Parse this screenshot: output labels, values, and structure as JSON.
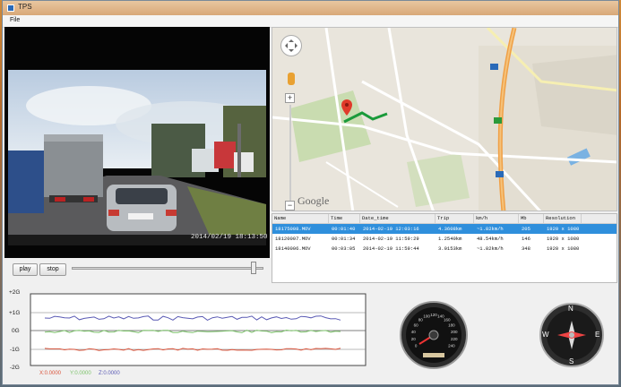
{
  "window": {
    "title": "TPS"
  },
  "menu": {
    "file": "File"
  },
  "video": {
    "timestamp": "2014/02/19 18:13:50"
  },
  "map": {
    "attribution": "Google",
    "zoom_in": "+",
    "zoom_out": "−"
  },
  "table": {
    "columns": [
      "Name",
      "Time",
      "Date_time",
      "Trip",
      "km/h",
      "Mb",
      "Resolution"
    ],
    "rows": [
      [
        "18175008.MOV",
        "00:01:40",
        "2014-02-19 12:03:16",
        "4.3608km",
        "~1.82km/h",
        "205",
        "1920 x 1080"
      ],
      [
        "18120007.MOV",
        "00:01:34",
        "2014-02-19 11:59:29",
        "1.2540km",
        "48.54km/h",
        "146",
        "1920 x 1080"
      ],
      [
        "18140006.MOV",
        "00:03:05",
        "2014-02-19 11:59:44",
        "3.0153km",
        "~1.82km/h",
        "348",
        "1920 x 1080"
      ]
    ],
    "selected_row": 0
  },
  "controls": {
    "play": "play",
    "stop": "stop",
    "position": 0.96
  },
  "gsensor": {
    "axis_labels": [
      "+2G",
      "+1G",
      "0G",
      "-1G",
      "-2G"
    ],
    "legend": {
      "x": "X:0.0000",
      "y": "Y:0.0000",
      "z": "Z:0.0000"
    },
    "colors": {
      "x": "#d9533a",
      "y": "#7cc36a",
      "z": "#5a5ab4"
    }
  },
  "speedometer": {
    "ticks": [
      "0",
      "20",
      "40",
      "60",
      "80",
      "100",
      "120",
      "140",
      "160",
      "180",
      "200",
      "220",
      "240"
    ]
  },
  "compass": {
    "n": "N",
    "s": "S",
    "w": "W",
    "e": "E"
  }
}
